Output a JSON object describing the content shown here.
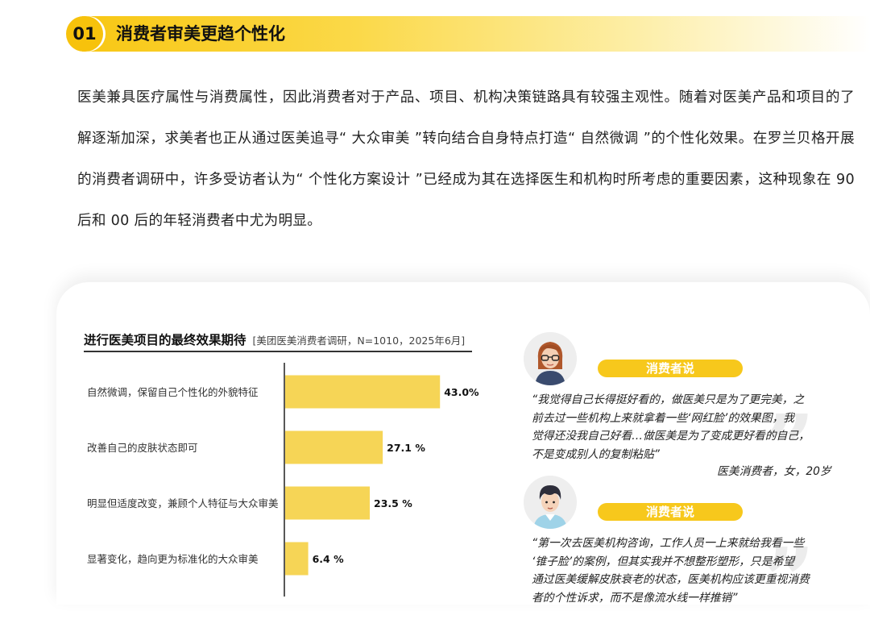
{
  "section": {
    "number": "01",
    "title": "消费者审美更趋个性化"
  },
  "intro_text": "医美兼具医疗属性与消费属性，因此消费者对于产品、项目、机构决策链路具有较强主观性。随着对医美产品和项目的了解逐渐加深，求美者也正从通过医美追寻“ 大众审美 ”转向结合自身特点打造“ 自然微调 ”的个性化效果。在罗兰贝格开展的消费者调研中，许多受访者认为“ 个性化方案设计 ”已经成为其在选择医生和机构时所考虑的重要因素，这种现象在 90 后和 00 后的年轻消费者中尤为明显。",
  "chart_data": {
    "type": "bar",
    "orientation": "horizontal",
    "title": "进行医美项目的最终效果期待",
    "source": "[美团医美消费者调研，N=1010，2025年6月]",
    "categories": [
      "自然微调，保留自己个性化的外貌特征",
      "改善自己的皮肤状态即可",
      "明显但适度改变，兼顾个人特征与大众审美",
      "显著变化，趋向更为标准化的大众审美"
    ],
    "values": [
      43.0,
      27.1,
      23.5,
      6.4
    ],
    "value_labels": [
      "43.0%",
      "27.1 %",
      "23.5 %",
      "6.4 %"
    ],
    "unit": "%",
    "xlim": [
      0,
      50
    ],
    "bar_color": "#f6d556",
    "grid": false,
    "legend": false
  },
  "quotes": [
    {
      "tag": "消费者说",
      "text_lines": [
        "“我觉得自己长得挺好看的，做医美只是为了更完美，之",
        "前去过一些机构上来就拿着一些‘网红脸’的效果图，我",
        "觉得还没我自己好看…做医美是为了变成更好看的自己，",
        "不是变成别人的复制粘贴”"
      ],
      "author": "医美消费者，女，20岁"
    },
    {
      "tag": "消费者说",
      "text_lines": [
        "“第一次去医美机构咨询，工作人员一上来就给我看一些",
        "‘锥子脸’的案例，但其实我并不想整形塑形，只是希望",
        "通过医美缓解皮肤衰老的状态，医美机构应该更重视消费",
        "者的个性诉求，而不是像流水线一样推销”"
      ]
    }
  ],
  "colors": {
    "accent_yellow": "#f7c20c",
    "bar_yellow": "#f6d556",
    "tag_yellow": "#f7c81c"
  }
}
